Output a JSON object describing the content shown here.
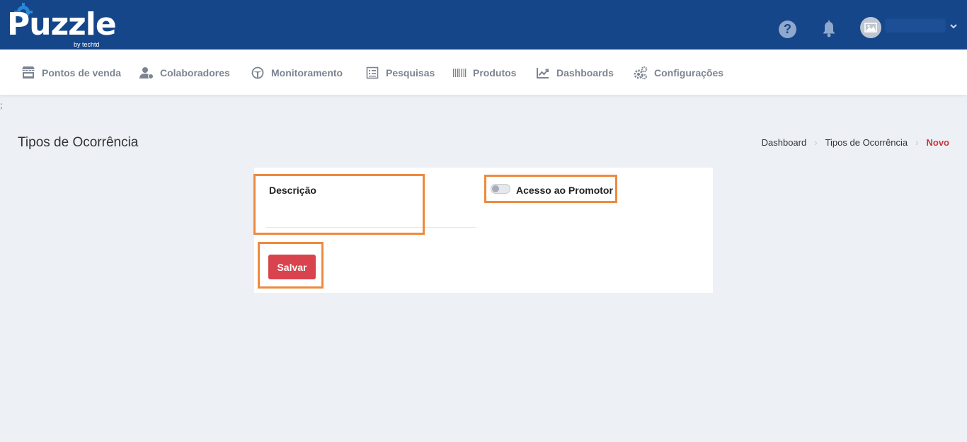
{
  "app": {
    "logo_text": "Puzzle",
    "logo_sub": "by techtd",
    "help_glyph": "?"
  },
  "nav": {
    "items": [
      {
        "label": "Pontos de venda",
        "icon": "store-icon"
      },
      {
        "label": "Colaboradores",
        "icon": "users-icon"
      },
      {
        "label": "Monitoramento",
        "icon": "monitor-icon"
      },
      {
        "label": "Pesquisas",
        "icon": "survey-icon"
      },
      {
        "label": "Produtos",
        "icon": "barcode-icon"
      },
      {
        "label": "Dashboards",
        "icon": "chart-line-icon"
      },
      {
        "label": "Configurações",
        "icon": "gears-icon"
      }
    ]
  },
  "stray_text": ";",
  "page": {
    "title": "Tipos de Ocorrência"
  },
  "breadcrumb": [
    "Dashboard",
    "Tipos de Ocorrência",
    "Novo"
  ],
  "form": {
    "descricao_label": "Descrição",
    "descricao_value": "",
    "toggle_label": "Acesso ao Promotor",
    "toggle_on": false,
    "save_label": "Salvar"
  },
  "colors": {
    "topbar": "#15468a",
    "accent": "#d9434e",
    "highlight": "#ee8a3e",
    "background": "#edf0f5"
  }
}
